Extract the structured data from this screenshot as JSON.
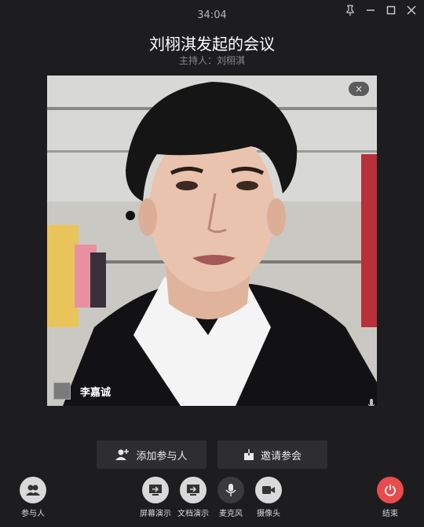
{
  "header": {
    "timer": "34:04",
    "title": "刘栩淇发起的会议",
    "host_label": "主持人：刘栩淇"
  },
  "window_controls": [
    "pin-icon",
    "minimize-icon",
    "maximize-icon",
    "close-icon"
  ],
  "video": {
    "participant_name": "李嘉诚",
    "close_glyph": "×"
  },
  "actions": {
    "add_participant": "添加参与人",
    "invite": "邀请参会"
  },
  "toolbar": {
    "participants": "参与人",
    "screen_share": "屏幕演示",
    "doc_share": "文档演示",
    "microphone": "麦克风",
    "camera": "摄像头",
    "end": "结束"
  },
  "colors": {
    "background": "#1d1d1f",
    "end_button": "#e84c4c",
    "button_bg": "#2e2e30"
  }
}
